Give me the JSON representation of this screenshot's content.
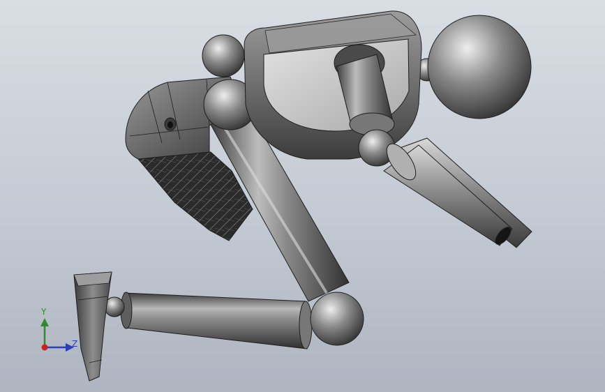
{
  "viewport": {
    "background_top": "#d9dde4",
    "background_bottom": "#aeb5c0"
  },
  "model": {
    "shade_light": "#c9c9c9",
    "shade_mid": "#7e7e7e",
    "shade_dark": "#3a3a3a",
    "edge_color": "#1e1e1e",
    "textured_panel_color": "#2a2a2a"
  },
  "triad": {
    "y_label": "Y",
    "z_label": "Z",
    "y_color": "#2e8b2e",
    "z_color": "#2a3fb8",
    "origin_color": "#cc2222"
  }
}
